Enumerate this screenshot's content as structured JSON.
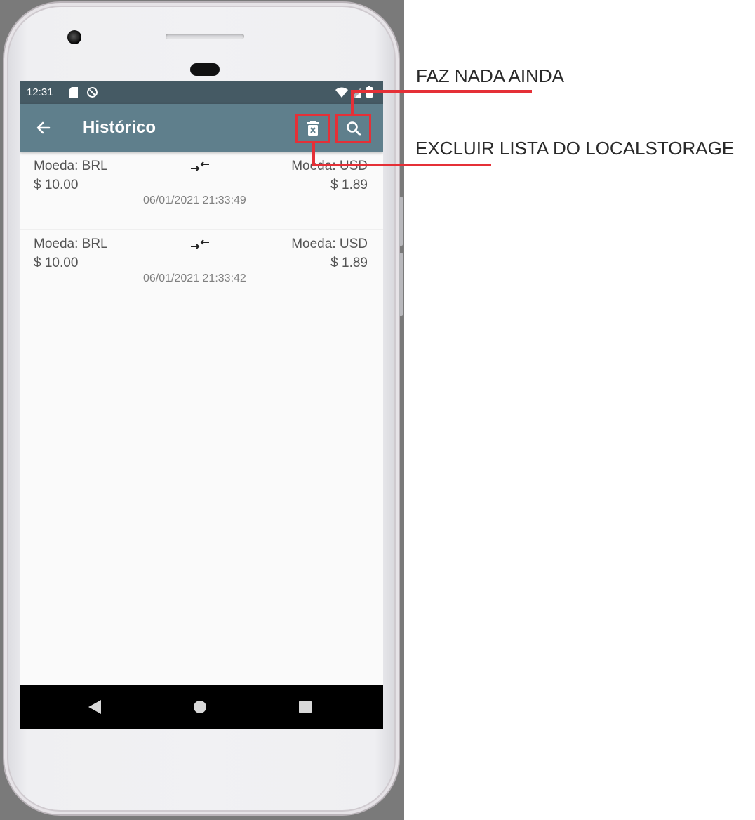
{
  "status_bar": {
    "time": "12:31",
    "icons": [
      "sd-card-icon",
      "sync-disabled-icon",
      "wifi-icon",
      "signal-icon",
      "battery-icon"
    ]
  },
  "app_bar": {
    "back_icon": "arrow-back-icon",
    "title": "Histórico",
    "actions": [
      {
        "icon": "delete-icon"
      },
      {
        "icon": "search-icon"
      }
    ]
  },
  "history": [
    {
      "from_label": "Moeda: BRL",
      "from_value": "$ 10.00",
      "to_label": "Moeda: USD",
      "to_value": "$ 1.89",
      "date": "06/01/2021 21:33:49"
    },
    {
      "from_label": "Moeda: BRL",
      "from_value": "$ 10.00",
      "to_label": "Moeda: USD",
      "to_value": "$ 1.89",
      "date": "06/01/2021 21:33:42"
    }
  ],
  "nav_bar": {
    "icons": [
      "nav-back-icon",
      "nav-home-icon",
      "nav-recents-icon"
    ]
  },
  "annotations": {
    "search": "FAZ NADA AINDA",
    "delete": "EXCLUIR LISTA DO LOCALSTORAGE"
  },
  "colors": {
    "status_bar": "#455a64",
    "app_bar": "#5f7f8c",
    "highlight": "#e53037",
    "screen_bg": "#fafafa"
  }
}
